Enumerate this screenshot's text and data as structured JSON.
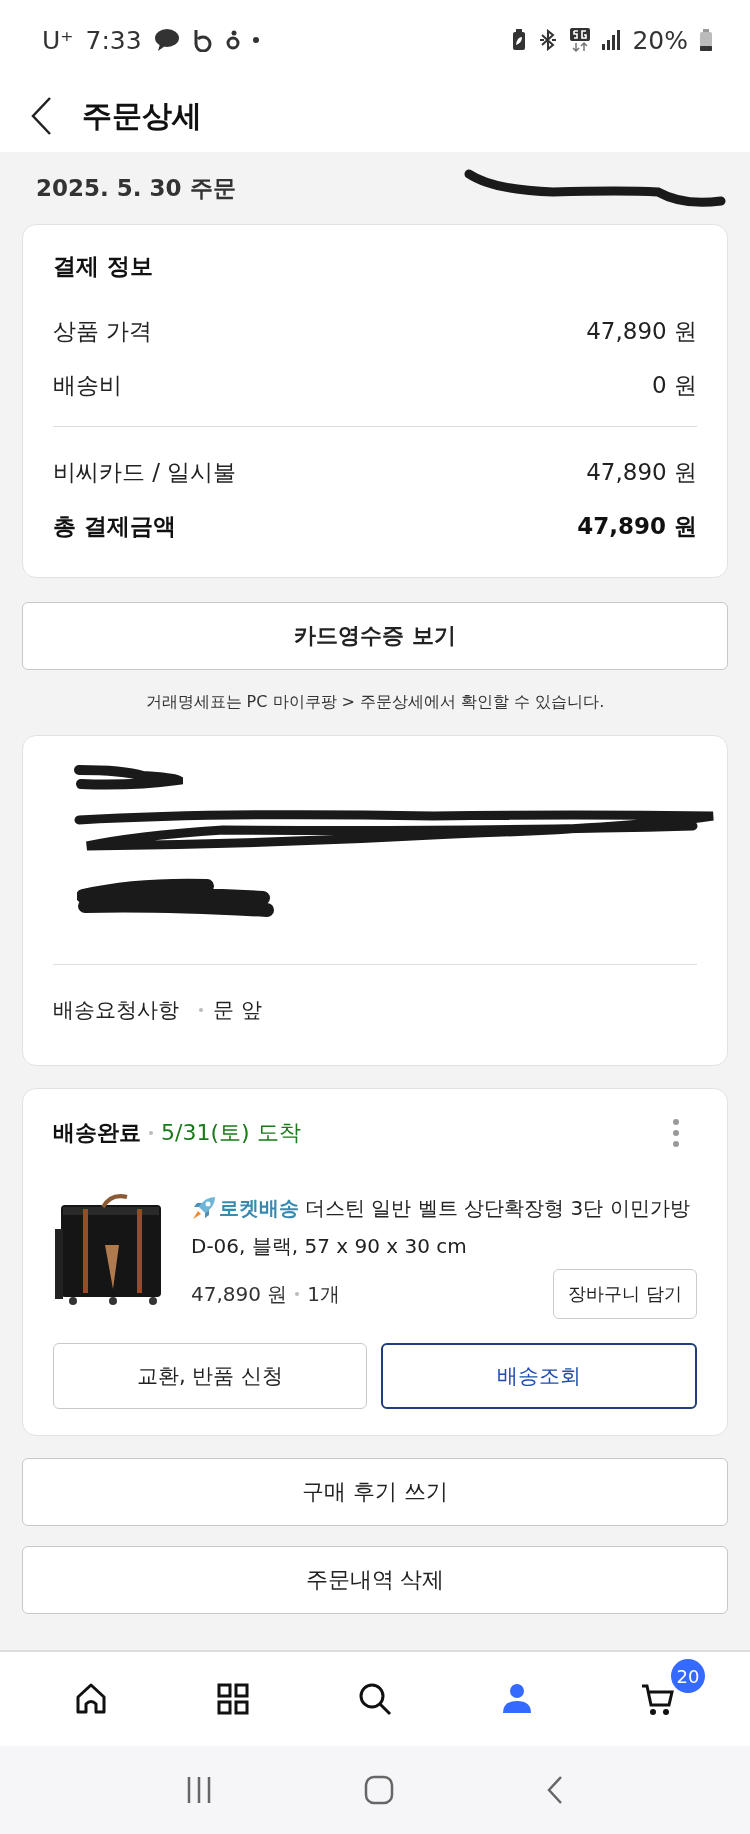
{
  "status_bar": {
    "carrier": "U⁺",
    "time": "7:33",
    "battery": "20%"
  },
  "header": {
    "title": "주문상세"
  },
  "order": {
    "date": "2025. 5. 30 주문"
  },
  "payment": {
    "title": "결제 정보",
    "rows": [
      {
        "kind": "normal",
        "label": "상품 가격",
        "value": "47,890 원"
      },
      {
        "kind": "normal",
        "label": "배송비",
        "value": "0 원"
      },
      {
        "kind": "divider"
      },
      {
        "kind": "normal",
        "label": "비씨카드 / 일시불",
        "value": "47,890 원"
      },
      {
        "kind": "total",
        "label": "총 결제금액",
        "value": "47,890 원"
      }
    ]
  },
  "receipt_button": "카드영수증 보기",
  "receipt_note": "거래명세표는 PC 마이쿠팡 > 주문상세에서 확인할 수 있습니다.",
  "address": {
    "request_label": "배송요청사항",
    "request_value": "문 앞"
  },
  "delivery": {
    "status": "배송완료",
    "arrival": "5/31(토) 도착",
    "product": {
      "badge": "로켓배송",
      "name_lines": [
        "더스틴 일반 벨트 상단확장형 3단 이민가방",
        "D-06, 블랙, 57 x 90 x 30 cm"
      ],
      "price": "47,890 원",
      "quantity": "1개"
    },
    "cart_button": "장바구니 담기",
    "buttons": [
      {
        "label": "교환, 반품 신청",
        "primary": false
      },
      {
        "label": "배송조회",
        "primary": true
      }
    ]
  },
  "actions": [
    "구매 후기 쓰기",
    "주문내역 삭제"
  ],
  "bottom_nav": [
    {
      "kind": "home",
      "selected": false
    },
    {
      "kind": "categories",
      "selected": false
    },
    {
      "kind": "search",
      "selected": false
    },
    {
      "kind": "account",
      "selected": true
    },
    {
      "kind": "cart",
      "selected": false,
      "badge": "20"
    }
  ]
}
